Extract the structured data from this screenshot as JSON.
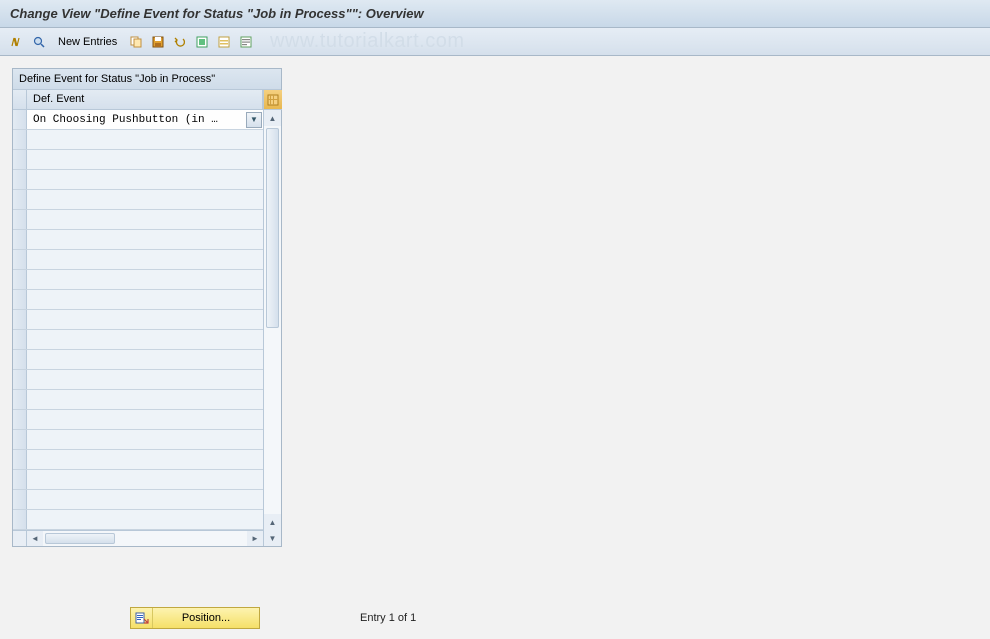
{
  "title": "Change View \"Define Event for Status \"Job in Process\"\": Overview",
  "toolbar": {
    "new_entries": "New Entries"
  },
  "watermark": "www.tutorialkart.com",
  "panel": {
    "header": "Define Event for Status \"Job in Process\"",
    "column_header": "Def. Event",
    "rows": [
      "On Choosing Pushbutton (in …",
      "",
      "",
      "",
      "",
      "",
      "",
      "",
      "",
      "",
      "",
      "",
      "",
      "",
      "",
      "",
      "",
      "",
      "",
      "",
      ""
    ]
  },
  "footer": {
    "position_label": "Position...",
    "entry_info": "Entry 1 of 1"
  }
}
